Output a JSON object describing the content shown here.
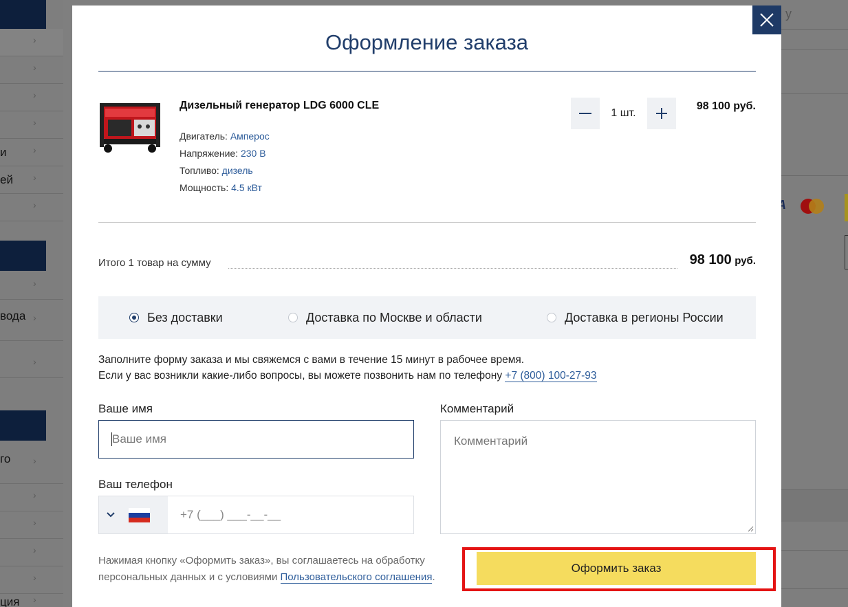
{
  "background": {
    "left_fragments": [
      "и",
      "ей",
      "вода",
      "го",
      "ция"
    ],
    "right_fragments": [
      "у",
      "A"
    ]
  },
  "modal": {
    "title": "Оформление заказа",
    "product": {
      "name": "Дизельный генератор LDG 6000 CLE",
      "properties": [
        {
          "label": "Двигатель: ",
          "value": "Амперос"
        },
        {
          "label": "Напряжение: ",
          "value": "230 В"
        },
        {
          "label": "Топливо: ",
          "value": "дизель"
        },
        {
          "label": "Мощность: ",
          "value": "4.5 кВт"
        }
      ],
      "quantity": "1 шт.",
      "price": "98 100 руб."
    },
    "total": {
      "label": "Итого 1 товар на сумму",
      "amount": "98 100",
      "currency": "руб."
    },
    "delivery_options": [
      {
        "label": "Без доставки",
        "selected": true
      },
      {
        "label": "Доставка по Москве и области",
        "selected": false
      },
      {
        "label": "Доставка в регионы России",
        "selected": false
      }
    ],
    "info_line1": "Заполните форму заказа и мы свяжемся с вами в течение 15 минут в рабочее время.",
    "info_line2": "Если у вас возникли какие-либо вопросы, вы можете позвонить нам по телефону ",
    "info_phone": "+7 (800) 100-27-93",
    "form": {
      "name_label": "Ваше имя",
      "name_placeholder": "Ваше имя",
      "phone_label": "Ваш телефон",
      "phone_mask": "+7 (___) ___-__-__",
      "comment_label": "Комментарий",
      "comment_placeholder": "Комментарий"
    },
    "agreement_text1": "Нажимая кнопку «Оформить заказ», вы соглашаетесь на обработку",
    "agreement_text2": "персональных данных и с условиями ",
    "agreement_link": "Пользовательского соглашения",
    "agreement_end": ".",
    "submit_label": "Оформить заказ"
  },
  "colors": {
    "accent": "#213e6b",
    "submit": "#f5dc5e",
    "highlight": "#e41414"
  }
}
